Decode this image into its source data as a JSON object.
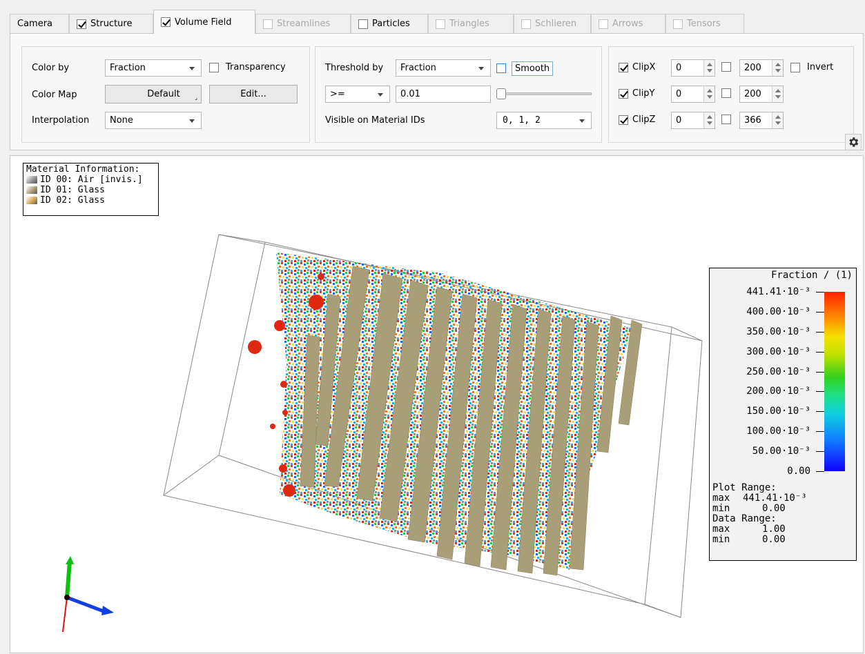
{
  "tabs": [
    {
      "label": "Camera",
      "checkbox": null,
      "checked": false,
      "enabled": true,
      "active": false
    },
    {
      "label": "Structure",
      "checkbox": true,
      "checked": true,
      "enabled": true,
      "active": false
    },
    {
      "label": "Volume Field",
      "checkbox": true,
      "checked": true,
      "enabled": true,
      "active": true
    },
    {
      "label": "Streamlines",
      "checkbox": true,
      "checked": false,
      "enabled": false,
      "active": false
    },
    {
      "label": "Particles",
      "checkbox": true,
      "checked": false,
      "enabled": true,
      "active": false
    },
    {
      "label": "Triangles",
      "checkbox": true,
      "checked": false,
      "enabled": false,
      "active": false
    },
    {
      "label": "Schlieren",
      "checkbox": true,
      "checked": false,
      "enabled": false,
      "active": false
    },
    {
      "label": "Arrows",
      "checkbox": true,
      "checked": false,
      "enabled": false,
      "active": false
    },
    {
      "label": "Tensors",
      "checkbox": true,
      "checked": false,
      "enabled": false,
      "active": false
    }
  ],
  "color_group": {
    "color_by_label": "Color by",
    "color_by_value": "Fraction",
    "transparency_label": "Transparency",
    "transparency_checked": false,
    "color_map_label": "Color Map",
    "color_map_value": "Default",
    "edit_label": "Edit...",
    "interpolation_label": "Interpolation",
    "interpolation_value": "None"
  },
  "threshold_group": {
    "threshold_by_label": "Threshold by",
    "threshold_by_value": "Fraction",
    "smooth_label": "Smooth",
    "smooth_checked": false,
    "operator_value": ">=",
    "threshold_value": "0.01",
    "slider_fraction": 0.0,
    "visible_ids_label": "Visible on Material IDs",
    "visible_ids_value": "0, 1, 2"
  },
  "clip_group": {
    "rows": [
      {
        "label": "ClipX",
        "checked": true,
        "min": "0",
        "max_checked": false,
        "max": "200"
      },
      {
        "label": "ClipY",
        "checked": true,
        "min": "0",
        "max_checked": false,
        "max": "200"
      },
      {
        "label": "ClipZ",
        "checked": true,
        "min": "0",
        "max_checked": false,
        "max": "366"
      }
    ],
    "invert_label": "Invert",
    "invert_checked": false
  },
  "settings_icon": "gear-icon",
  "materials": {
    "title": "Material Information:",
    "items": [
      {
        "label": "ID 00: Air [invis.]",
        "color": "#8f8f8f"
      },
      {
        "label": "ID 01: Glass",
        "color": "#a59a6e"
      },
      {
        "label": "ID 02: Glass",
        "color": "#d2a24c"
      }
    ]
  },
  "legend": {
    "title": "Fraction / (1)",
    "ticks": [
      "441.41·10⁻³",
      "400.00·10⁻³",
      "350.00·10⁻³",
      "300.00·10⁻³",
      "250.00·10⁻³",
      "200.00·10⁻³",
      "150.00·10⁻³",
      "100.00·10⁻³",
      "50.00·10⁻³",
      "0.00"
    ],
    "plot_range_label": "Plot Range:",
    "plot_max_label": "max",
    "plot_max": "441.41·10⁻³",
    "plot_min_label": "min",
    "plot_min": "0.00",
    "data_range_label": "Data Range:",
    "data_max_label": "max",
    "data_max": "1.00",
    "data_min_label": "min",
    "data_min": "0.00"
  }
}
